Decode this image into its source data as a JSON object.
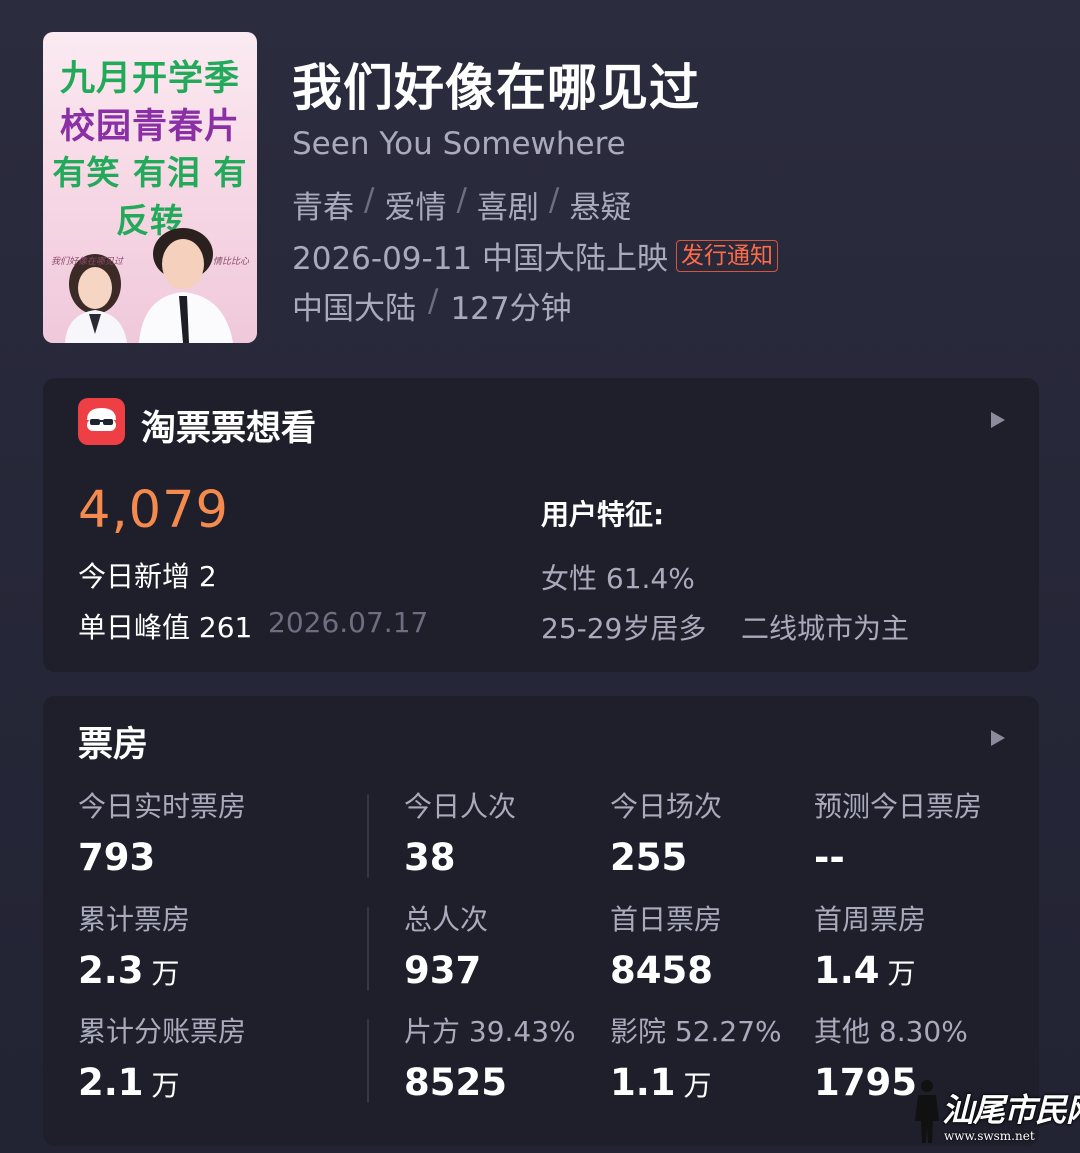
{
  "poster": {
    "line1": "九月开学季",
    "line2": "校园青春片",
    "line3": "有笑 有泪 有反转",
    "script_left": "我们好像在哪见过",
    "script_right": "情比比心"
  },
  "movie": {
    "title": "我们好像在哪见过",
    "english_title": "Seen You Somewhere",
    "genres": [
      "青春",
      "爱情",
      "喜剧",
      "悬疑"
    ],
    "genre_separator": "/",
    "release": "2026-09-11 中国大陆上映",
    "release_badge": "发行通知",
    "region": "中国大陆",
    "duration": "127分钟"
  },
  "want_card": {
    "title": "淘票票想看",
    "count": "4,079",
    "today_new": "今日新增 2",
    "peak": "单日峰值 261",
    "peak_date": "2026.07.17",
    "user_traits_label": "用户特征:",
    "gender": "女性 61.4%",
    "age": "25-29岁居多",
    "city": "二线城市为主"
  },
  "box_card": {
    "title": "票房",
    "stats": [
      {
        "label": "今日实时票房",
        "value": "793",
        "unit": ""
      },
      {
        "label": "今日人次",
        "value": "38",
        "unit": ""
      },
      {
        "label": "今日场次",
        "value": "255",
        "unit": ""
      },
      {
        "label": "预测今日票房",
        "value": "--",
        "unit": ""
      },
      {
        "label": "累计票房",
        "value": "2.3",
        "unit": "万"
      },
      {
        "label": "总人次",
        "value": "937",
        "unit": ""
      },
      {
        "label": "首日票房",
        "value": "8458",
        "unit": ""
      },
      {
        "label": "首周票房",
        "value": "1.4",
        "unit": "万"
      },
      {
        "label": "累计分账票房",
        "value": "2.1",
        "unit": "万"
      },
      {
        "label": "片方 39.43%",
        "value": "8525",
        "unit": ""
      },
      {
        "label": "影院 52.27%",
        "value": "1.1",
        "unit": "万"
      },
      {
        "label": "其他 8.30%",
        "value": "1795",
        "unit": ""
      }
    ]
  },
  "watermark": {
    "name": "汕尾市民网",
    "url": "www.swsm.net"
  },
  "colors": {
    "accent_orange": "#f58a4f",
    "badge_red": "#ff6a47",
    "taopiao_red": "#ee3f45",
    "card_bg": "#1e1f2b"
  }
}
